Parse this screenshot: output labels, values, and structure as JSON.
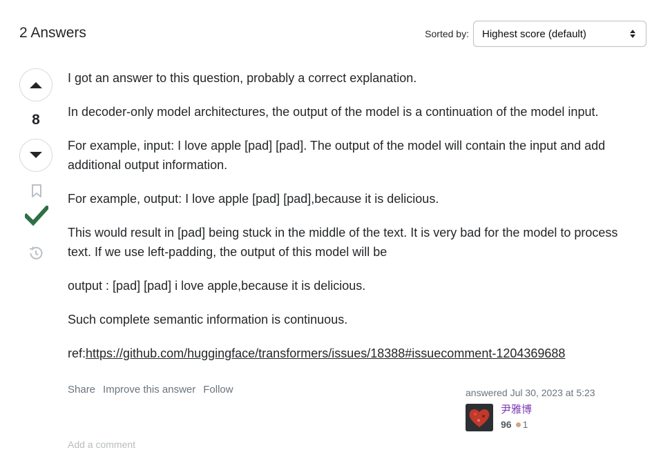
{
  "header": {
    "answers_count_title": "2 Answers",
    "sort_label": "Sorted by:",
    "sort_value": "Highest score (default)"
  },
  "vote": {
    "score": "8"
  },
  "post": {
    "paragraphs": [
      "I got an answer to this question, probably a correct explanation.",
      "In decoder-only model architectures, the output of the model is a continuation of the model input.",
      "For example, input: I love apple [pad] [pad]. The output of the model will contain the input and add additional output information.",
      "For example, output: I love apple [pad] [pad],because it is delicious.",
      "This would result in [pad] being stuck in the middle of the text. It is very bad for the model to process text. If we use left-padding, the output of this model will be",
      "output : [pad] [pad] i love apple,because it is delicious.",
      "Such complete semantic information is continuous."
    ],
    "ref_prefix": "ref:",
    "ref_link": "https://github.com/huggingface/transformers/issues/18388#issuecomment-1204369688"
  },
  "menu": {
    "share": "Share",
    "improve": "Improve this answer",
    "follow": "Follow"
  },
  "signature": {
    "action": "answered",
    "date": "Jul 30, 2023 at 5:23",
    "user_name": "尹雅博",
    "reputation": "96",
    "bronze_badges": "1"
  },
  "footer": {
    "add_comment": "Add a comment"
  },
  "colors": {
    "accepted_green": "#2f6f44",
    "link_purple": "#7c3bb3",
    "bronze": "#d1a684"
  },
  "icons": [
    "up-arrow-icon",
    "down-arrow-icon",
    "bookmark-icon",
    "checkmark-icon",
    "history-icon",
    "sort-arrows-icon"
  ]
}
